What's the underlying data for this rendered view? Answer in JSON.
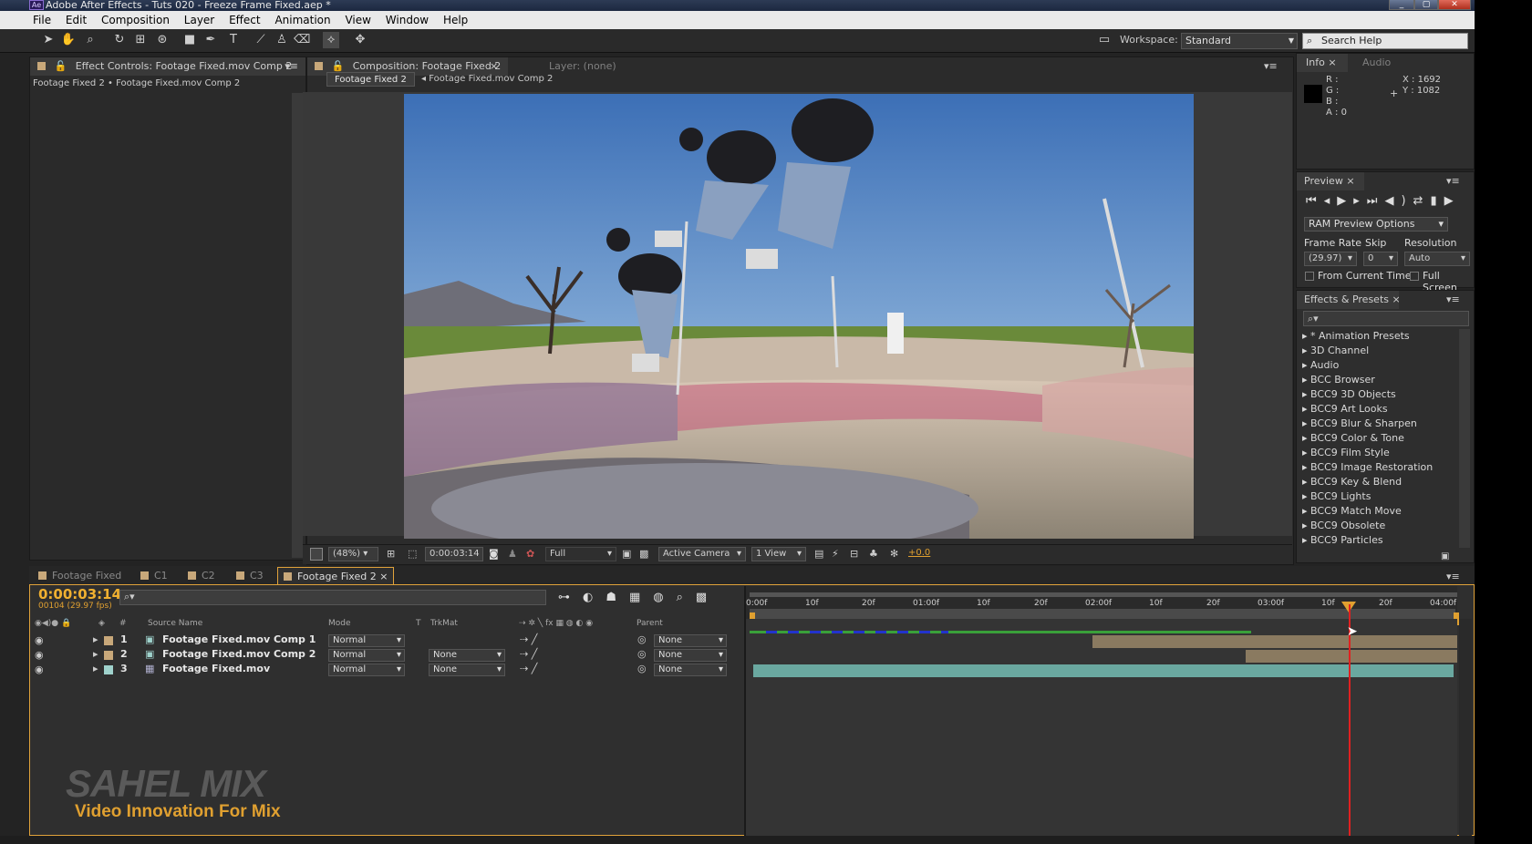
{
  "window": {
    "title": "Adobe After Effects - Tuts 020 - Freeze Frame Fixed.aep *",
    "controls": [
      "_",
      "▢",
      "✕"
    ]
  },
  "menu": [
    "File",
    "Edit",
    "Composition",
    "Layer",
    "Effect",
    "Animation",
    "View",
    "Window",
    "Help"
  ],
  "toolbar": {
    "workspace_label": "Workspace:",
    "workspace_value": "Standard",
    "search_help": "Search Help"
  },
  "effect_controls": {
    "tab": "Effect Controls: Footage Fixed.mov Comp 2",
    "breadcrumb": "Footage Fixed 2 • Footage Fixed.mov Comp 2"
  },
  "composition": {
    "tab": "Composition: Footage Fixed 2",
    "layer_tab": "Layer: (none)",
    "flow_active": "Footage Fixed 2",
    "flow_next": "Footage Fixed.mov Comp 2",
    "zoom": "(48%)",
    "timecode": "0:00:03:14",
    "resolution": "Full",
    "camera": "Active Camera",
    "views": "1 View",
    "exposure": "+0.0"
  },
  "info": {
    "tab": "Info",
    "tab2": "Audio",
    "r": "R :",
    "g": "G :",
    "b": "B :",
    "a": "A : 0",
    "x": "X : 1692",
    "y": "Y : 1082"
  },
  "preview": {
    "tab": "Preview",
    "ram": "RAM Preview Options",
    "frame_rate_label": "Frame Rate",
    "skip_label": "Skip",
    "resolution_label": "Resolution",
    "frame_rate": "(29.97)",
    "skip": "0",
    "resolution": "Auto",
    "from_current": "From Current Time",
    "full_screen": "Full Screen"
  },
  "effects_presets": {
    "tab": "Effects & Presets",
    "search_placeholder": "",
    "items": [
      "* Animation Presets",
      "3D Channel",
      "Audio",
      "BCC Browser",
      "BCC9 3D Objects",
      "BCC9 Art Looks",
      "BCC9 Blur & Sharpen",
      "BCC9 Color & Tone",
      "BCC9 Film Style",
      "BCC9 Image Restoration",
      "BCC9 Key & Blend",
      "BCC9 Lights",
      "BCC9 Match Move",
      "BCC9 Obsolete",
      "BCC9 Particles"
    ]
  },
  "timeline": {
    "tabs": [
      "Footage Fixed",
      "C1",
      "C2",
      "C3",
      "Footage Fixed 2"
    ],
    "active_tab": "Footage Fixed 2",
    "timecode": "0:00:03:14",
    "fps": "00104 (29.97 fps)",
    "columns": {
      "num": "#",
      "source": "Source Name",
      "mode": "Mode",
      "t": "T",
      "trkmat": "TrkMat",
      "parent": "Parent"
    },
    "layers": [
      {
        "num": "1",
        "name": "Footage Fixed.mov Comp 1",
        "mode": "Normal",
        "trkmat": "",
        "parent": "None",
        "color": "#c8a87a"
      },
      {
        "num": "2",
        "name": "Footage Fixed.mov Comp 2",
        "mode": "Normal",
        "trkmat": "None",
        "parent": "None",
        "color": "#c8a87a"
      },
      {
        "num": "3",
        "name": "Footage Fixed.mov",
        "mode": "Normal",
        "trkmat": "None",
        "parent": "None",
        "color": "#9fd2cc"
      }
    ],
    "ruler": [
      "0:00f",
      "10f",
      "20f",
      "01:00f",
      "10f",
      "20f",
      "02:00f",
      "10f",
      "20f",
      "03:00f",
      "10f",
      "20f",
      "04:00f"
    ]
  },
  "watermark": {
    "line1": "SAHEL MIX",
    "line2": "Video Innovation For Mix"
  },
  "colors": {
    "accent": "#e0a030",
    "playhead": "#e02020",
    "panel": "#2e2e2e"
  }
}
